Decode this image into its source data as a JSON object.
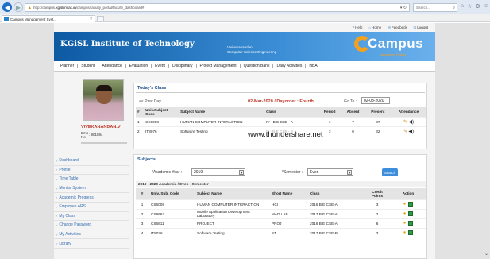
{
  "browser": {
    "address": {
      "prefix": "http://campus.",
      "host": "kgisliim.ac.in",
      "path": "/campus/faculty_portal/faculty_dashboard#",
      "reload": "▾ ↻"
    },
    "search_placeholder": "Search...",
    "tab_title": "Campus Management Syst...",
    "tab_close": "×"
  },
  "toplinks": [
    {
      "icon": "?",
      "label": "Help"
    },
    {
      "icon": "⌂",
      "label": "Home"
    },
    {
      "icon": "✉",
      "label": "Feedback"
    },
    {
      "icon": "⏻",
      "label": "Logout"
    }
  ],
  "header": {
    "institute": "KGiSL Institute of Technology",
    "user_name": "V.vivekanandan",
    "user_dept": "Computer Science Engineering",
    "logo_text": "Campus",
    "logo_sub": "Management System"
  },
  "menu": [
    "Planner",
    "Student",
    "Attendance",
    "Evaluation",
    "Event",
    "Disciplinary",
    "Project Management",
    "Question Bank",
    "Daily Activities",
    "NBA"
  ],
  "profile": {
    "name": "VIVEKANANDAN.V",
    "emp_label": "Emp No",
    "emp_value": ": 901884"
  },
  "sidebar": [
    "Dashboard",
    "Profile",
    "Time Table",
    "Mentor System",
    "Academic Progress",
    "Employee ARS",
    "My Class",
    "Change Password",
    "My Activities",
    "Library"
  ],
  "today": {
    "title": "Today's Class",
    "prev_day": "<< Prev Day",
    "dayorder": "02-Mar-2020 / Dayorder : Fourth",
    "goto_label": "Go To :",
    "goto_value": "02-03-2020",
    "headers": [
      "#",
      "Univ.Subject Code",
      "Subject Name",
      "Class",
      "Period",
      "Absent",
      "Present",
      "Attendance"
    ],
    "rows": [
      {
        "n": "1",
        "code": "CS6008",
        "name": "HUMAN COMPUTER INTERACTION",
        "cls": "IV - B.E CSE - A",
        "period": "1",
        "absent": "7",
        "present": "37"
      },
      {
        "n": "2",
        "code": "IT8076",
        "name": "Software Testing",
        "cls": "III - B.E CSE - B",
        "period": "3",
        "absent": "0",
        "present": "32"
      }
    ],
    "watermark": "www.thundershare.net"
  },
  "subjects": {
    "title": "Subjects",
    "year_label": "*Academic Year :",
    "year_value": "2019",
    "sem_label": "*Semester :",
    "sem_value": "Even",
    "search_label": "Search",
    "sem_header": "2019 - 2020 Academic / Even - Semester",
    "headers": [
      "#",
      "Univ. Sub. Code",
      "Subject Name",
      "Short Name",
      "Class",
      "Credit Points",
      "Action"
    ],
    "rows": [
      {
        "n": "1",
        "code": "CS6008",
        "name": "HUMAN COMPUTER INTERACTION",
        "short": "HCI",
        "cls": "2016 B.E CSE-A",
        "credit": "3"
      },
      {
        "n": "2",
        "code": "CS8662",
        "name": "Mobile Application Development Laboratory",
        "short": "MAD LAB",
        "cls": "2017 B.E CSE-A",
        "credit": "2"
      },
      {
        "n": "3",
        "code": "CS6811",
        "name": "PROJECT",
        "short": "PROJ",
        "cls": "2016 B.E CSE-A",
        "credit": "6"
      },
      {
        "n": "4",
        "code": "IT8076",
        "name": "Software Testing",
        "short": "ST",
        "cls": "2017 B.E CSE-B",
        "credit": "3"
      }
    ]
  }
}
